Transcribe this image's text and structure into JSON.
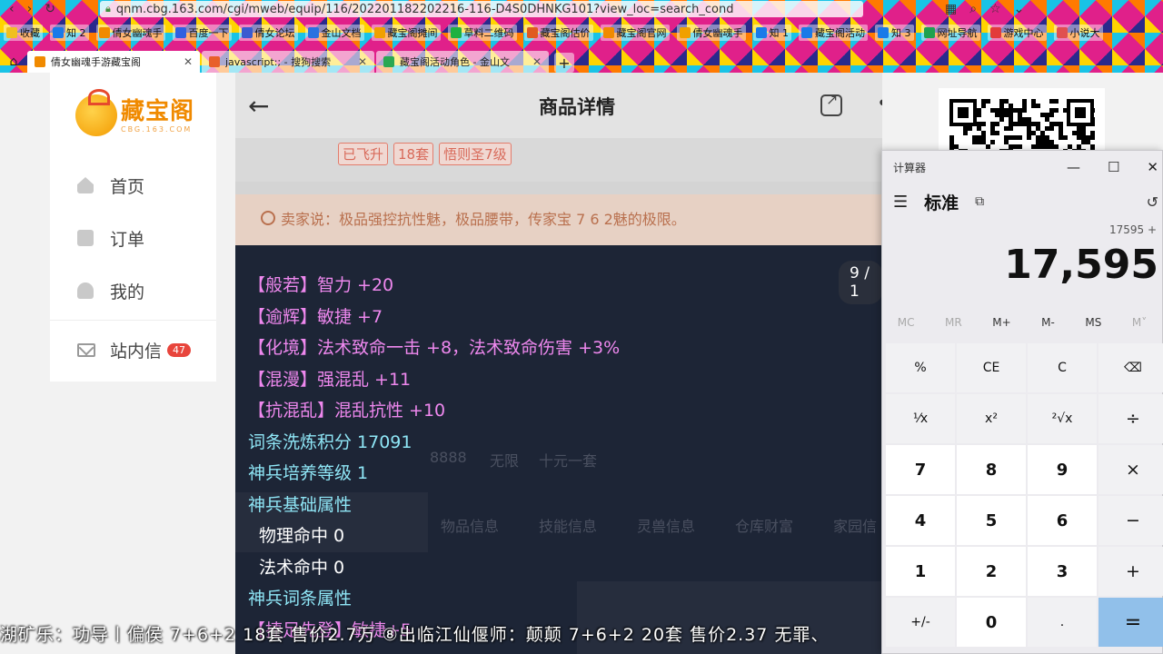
{
  "browser": {
    "url": "qnm.cbg.163.com/cgi/mweb/equip/116/202201182202216-116-D4S0DHNKG101?view_loc=search_cond",
    "bookmarks": [
      {
        "label": "收藏",
        "color": "#f0c020"
      },
      {
        "label": "知 2",
        "color": "#1a7ae8"
      },
      {
        "label": "倩女幽魂手",
        "color": "#f08a00"
      },
      {
        "label": "百度一下",
        "color": "#3060e0"
      },
      {
        "label": "倩女论坛",
        "color": "#3a5bd0"
      },
      {
        "label": "金山文档",
        "color": "#2a72e0"
      },
      {
        "label": "藏宝阁摊间",
        "color": "#f0a000"
      },
      {
        "label": "草料二维码",
        "color": "#1fb141"
      },
      {
        "label": "藏宝阁估价",
        "color": "#e05b20"
      },
      {
        "label": "藏宝阁官网",
        "color": "#f08a00"
      },
      {
        "label": "倩女幽魂手",
        "color": "#f0a000"
      },
      {
        "label": "知 1",
        "color": "#1a7ae8"
      },
      {
        "label": "藏宝阁活动",
        "color": "#1a7ae8"
      },
      {
        "label": "知 3",
        "color": "#1a7ae8"
      },
      {
        "label": "网址导航",
        "color": "#1fa14f"
      },
      {
        "label": "游戏中心",
        "color": "#e23b3b"
      },
      {
        "label": "小说大",
        "color": "#e05050"
      }
    ],
    "tabs": [
      {
        "label": "倩女幽魂手游藏宝阁",
        "active": true,
        "color": "#f08a00"
      },
      {
        "label": "javascript:; - 搜狗搜索",
        "active": false,
        "color": "#e8602a"
      },
      {
        "label": "藏宝阁活动角色 - 金山文",
        "active": false,
        "color": "#2aa852"
      }
    ]
  },
  "sidebar": {
    "logo": "藏宝阁",
    "logo_sub": "CBG.163.COM",
    "items": [
      {
        "label": "首页",
        "icon": "home-icon"
      },
      {
        "label": "订单",
        "icon": "order-icon"
      },
      {
        "label": "我的",
        "icon": "user-icon"
      }
    ],
    "inbox": {
      "label": "站内信",
      "count": "47"
    }
  },
  "panel": {
    "title": "商品详情",
    "tags": [
      "已飞升",
      "18套",
      "悟则圣7级"
    ],
    "seller_note": "卖家说：极品强控抗性魅，极品腰带，传家宝 7 6 2魅的极限。",
    "counter": "9 / 1",
    "ghost_lines": [
      "8888",
      "无限",
      "十元一套"
    ],
    "attributes": [
      {
        "text": "【般若】智力 +20",
        "color": "pink",
        "indent": false
      },
      {
        "text": "【逾辉】敏捷 +7",
        "color": "pink",
        "indent": false
      },
      {
        "text": "【化境】法术致命一击 +8，法术致命伤害 +3%",
        "color": "pink",
        "indent": false
      },
      {
        "text": "【混漫】强混乱 +11",
        "color": "pink",
        "indent": false
      },
      {
        "text": "【抗混乱】混乱抗性 +10",
        "color": "pink",
        "indent": false
      },
      {
        "text": "词条洗炼积分 17091",
        "color": "cyan",
        "indent": false
      },
      {
        "text": "神兵培养等级 1",
        "color": "cyan",
        "indent": false
      },
      {
        "text": "神兵基础属性",
        "color": "cyan",
        "indent": false
      },
      {
        "text": "物理命中 0",
        "color": "white",
        "indent": true
      },
      {
        "text": "法术命中 0",
        "color": "white",
        "indent": true
      },
      {
        "text": "神兵词条属性",
        "color": "cyan",
        "indent": false
      },
      {
        "text": "【捷足先登】敏捷+5",
        "color": "pink",
        "indent": false
      }
    ],
    "ghost_tabs": [
      "物品信息",
      "技能信息",
      "灵兽信息",
      "仓库财富",
      "家园信"
    ]
  },
  "calculator": {
    "window_title": "计算器",
    "mode": "标准",
    "expression": "17595 +",
    "display": "17,595",
    "memory": [
      {
        "label": "MC",
        "enabled": false
      },
      {
        "label": "MR",
        "enabled": false
      },
      {
        "label": "M+",
        "enabled": true
      },
      {
        "label": "M-",
        "enabled": true
      },
      {
        "label": "MS",
        "enabled": true
      },
      {
        "label": "M˅",
        "enabled": false
      }
    ],
    "keys": [
      {
        "label": "%",
        "kind": "fn"
      },
      {
        "label": "CE",
        "kind": "fn"
      },
      {
        "label": "C",
        "kind": "fn"
      },
      {
        "label": "⌫",
        "kind": "fn"
      },
      {
        "label": "¹⁄x",
        "kind": "fn"
      },
      {
        "label": "x²",
        "kind": "fn"
      },
      {
        "label": "²√x",
        "kind": "fn"
      },
      {
        "label": "÷",
        "kind": "op"
      },
      {
        "label": "7",
        "kind": "num"
      },
      {
        "label": "8",
        "kind": "num"
      },
      {
        "label": "9",
        "kind": "num"
      },
      {
        "label": "×",
        "kind": "op"
      },
      {
        "label": "4",
        "kind": "num"
      },
      {
        "label": "5",
        "kind": "num"
      },
      {
        "label": "6",
        "kind": "num"
      },
      {
        "label": "−",
        "kind": "op"
      },
      {
        "label": "1",
        "kind": "num"
      },
      {
        "label": "2",
        "kind": "num"
      },
      {
        "label": "3",
        "kind": "num"
      },
      {
        "label": "+",
        "kind": "op"
      },
      {
        "label": "+/-",
        "kind": "fn"
      },
      {
        "label": "0",
        "kind": "num"
      },
      {
        "label": ".",
        "kind": "fn"
      },
      {
        "label": "=",
        "kind": "eq"
      }
    ]
  },
  "marquee": "湖矿乐：功导丨偏侯 7+6+2 18套 售价2.7万 ⑧出临江仙偃师：颠颠 7+6+2 20套 售价2.37 无罪、"
}
